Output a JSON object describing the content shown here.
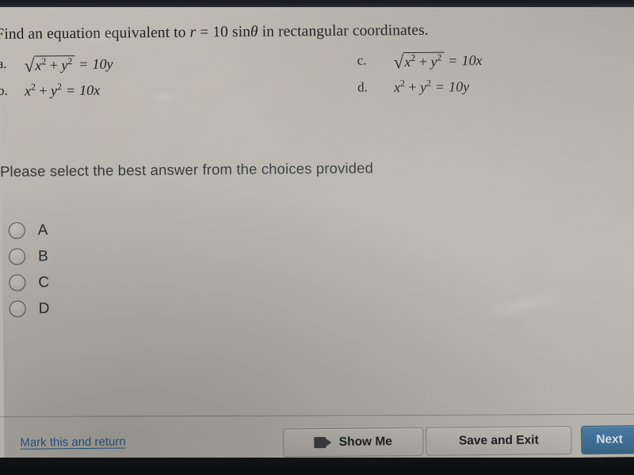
{
  "question": {
    "prompt_prefix": "Find an equation equivalent to ",
    "prompt_math_r": "r",
    "prompt_math_eq": " = 10 sin",
    "prompt_math_theta": "θ",
    "prompt_suffix": " in rectangular coordinates."
  },
  "choices": [
    {
      "letter": "a.",
      "has_radical": true,
      "radicand_x": "x",
      "radicand_x_exp": "2",
      "radicand_plus": " + ",
      "radicand_y": "y",
      "radicand_y_exp": "2",
      "equals": "=",
      "rhs": "10y"
    },
    {
      "letter": "b.",
      "has_radical": false,
      "radicand_x": "x",
      "radicand_x_exp": "2",
      "radicand_plus": " + ",
      "radicand_y": "y",
      "radicand_y_exp": "2",
      "equals": "=",
      "rhs": "10x"
    },
    {
      "letter": "c.",
      "has_radical": true,
      "radicand_x": "x",
      "radicand_x_exp": "2",
      "radicand_plus": " + ",
      "radicand_y": "y",
      "radicand_y_exp": "2",
      "equals": "=",
      "rhs": "10x"
    },
    {
      "letter": "d.",
      "has_radical": false,
      "radicand_x": "x",
      "radicand_x_exp": "2",
      "radicand_plus": " + ",
      "radicand_y": "y",
      "radicand_y_exp": "2",
      "equals": "=",
      "rhs": "10y"
    }
  ],
  "instruction": "Please select the best answer from the choices provided",
  "answer_options": [
    {
      "label": "A",
      "selected": false
    },
    {
      "label": "B",
      "selected": false
    },
    {
      "label": "C",
      "selected": false
    },
    {
      "label": "D",
      "selected": false
    }
  ],
  "footer": {
    "mark_link": "Mark this and return",
    "show_me_button": "Show Me",
    "save_exit_button": "Save and Exit",
    "next_button": "Next"
  },
  "colors": {
    "screen_background": "#b8b5ad",
    "text_primary": "#1e1e20",
    "link_blue": "#2a5a86",
    "next_button_blue": "#3d6c92",
    "bezel_dark": "#0b0b0d"
  }
}
